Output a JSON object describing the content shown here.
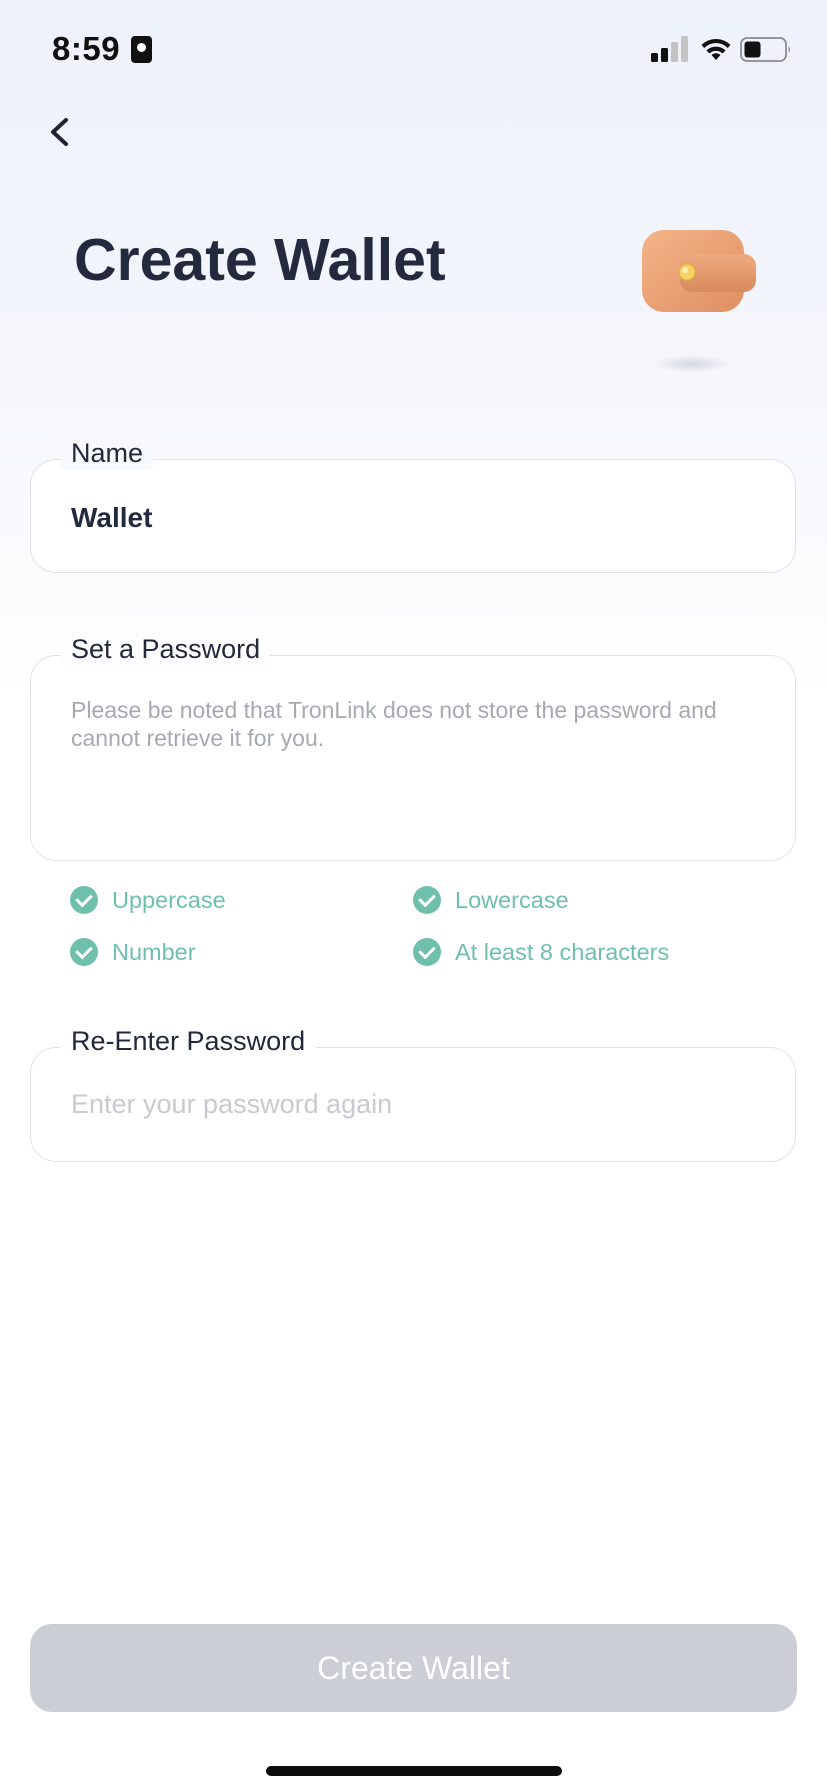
{
  "status_bar": {
    "time": "8:59",
    "icons": [
      "id-badge-icon",
      "signal-icon",
      "wifi-icon",
      "battery-icon"
    ]
  },
  "nav": {
    "back_icon": "chevron-left-icon"
  },
  "header": {
    "title": "Create Wallet",
    "illustration": "wallet-illustration"
  },
  "form": {
    "name": {
      "label": "Name",
      "value": "Wallet"
    },
    "password": {
      "label": "Set a Password",
      "placeholder": "Please be noted that TronLink does not store the password and cannot retrieve it for you.",
      "requirements": [
        {
          "label": "Uppercase",
          "met": true
        },
        {
          "label": "Lowercase",
          "met": true
        },
        {
          "label": "Number",
          "met": true
        },
        {
          "label": "At least 8 characters",
          "met": true
        }
      ]
    },
    "reenter": {
      "label": "Re-Enter Password",
      "placeholder": "Enter your password again"
    }
  },
  "footer": {
    "create_button_label": "Create Wallet",
    "create_button_enabled": false
  },
  "colors": {
    "title": "#232a3d",
    "requirement_met": "#6fbfad",
    "button_disabled": "#ccced6",
    "field_border": "#e1e3ea"
  }
}
